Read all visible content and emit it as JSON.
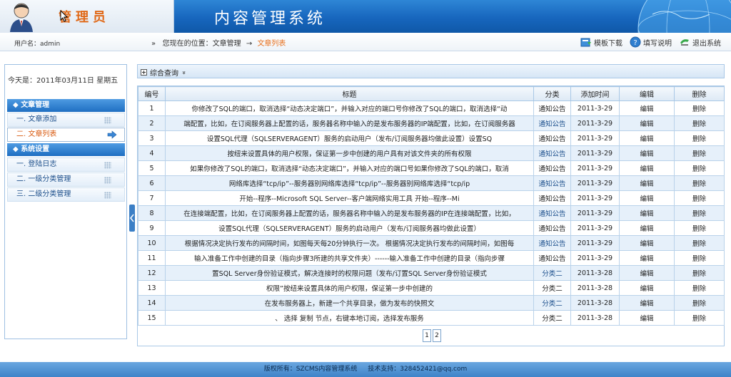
{
  "header": {
    "admin_title": "管理员",
    "system_title": "内容管理系统"
  },
  "bar2": {
    "username": "用户名：admin",
    "crumb_prefix": "»",
    "crumb_location": "您现在的位置：文章管理",
    "crumb_arrow": "→",
    "crumb_current": "文章列表",
    "toolbar": [
      {
        "label": "模板下载",
        "icon": "download-icon"
      },
      {
        "label": "填写说明",
        "icon": "help-icon"
      },
      {
        "label": "退出系统",
        "icon": "exit-icon"
      }
    ]
  },
  "sidebar": {
    "date": "今天是：2011年03月11日 星期五",
    "sections": [
      {
        "title": "文章管理",
        "items": [
          "一. 文章添加",
          "二. 文章列表"
        ]
      },
      {
        "title": "系统设置",
        "items": [
          "一. 登陆日志",
          "二. 一级分类管理",
          "三. 二级分类管理"
        ]
      }
    ]
  },
  "query": {
    "label": "综合查询",
    "toggle": "»"
  },
  "table": {
    "headers": [
      "编号",
      "标题",
      "分类",
      "添加时间",
      "编辑",
      "删除"
    ],
    "rows": [
      {
        "id": "1",
        "title": "你修改了SQL的端口，取消选择“动态决定端口”，并输入对应的端口号你修改了SQL的端口，取消选择“动",
        "cat": "通知公告",
        "date": "2011-3-29",
        "edit": "编辑",
        "del": "删除"
      },
      {
        "id": "2",
        "title": "端配置，比如，在订阅服务器上配置的话，服务器名称中输入的是发布服务器的IP端配置，比如，在订阅服务器",
        "cat": "通知公告",
        "date": "2011-3-29",
        "edit": "编辑",
        "del": "删除"
      },
      {
        "id": "3",
        "title": "设置SQL代理（SQLSERVERAGENT）服务的启动用户（发布/订阅服务器均做此设置）设置SQ",
        "cat": "通知公告",
        "date": "2011-3-29",
        "edit": "编辑",
        "del": "删除"
      },
      {
        "id": "4",
        "title": "按纽来设置具体的用户权限，保证第一步中创建的用户具有对该文件夹的所有权限",
        "cat": "通知公告",
        "date": "2011-3-29",
        "edit": "编辑",
        "del": "删除"
      },
      {
        "id": "5",
        "title": "如果你修改了SQL的端口，取消选择“动态决定端口”，并输入对应的端口号如果你修改了SQL的端口，取消",
        "cat": "通知公告",
        "date": "2011-3-29",
        "edit": "编辑",
        "del": "删除"
      },
      {
        "id": "6",
        "title": "网络库选择“tcp/ip”--服务器别网络库选择“tcp/ip”--服务器别网络库选择“tcp/ip",
        "cat": "通知公告",
        "date": "2011-3-29",
        "edit": "编辑",
        "del": "删除"
      },
      {
        "id": "7",
        "title": "开始--程序--Microsoft SQL Server--客户端网络实用工具 开始--程序--Mi",
        "cat": "通知公告",
        "date": "2011-3-29",
        "edit": "编辑",
        "del": "删除"
      },
      {
        "id": "8",
        "title": "在连接端配置，比如，在订阅服务器上配置的话，服务器名称中输入的是发布服务器的IP在连接端配置，比如，",
        "cat": "通知公告",
        "date": "2011-3-29",
        "edit": "编辑",
        "del": "删除"
      },
      {
        "id": "9",
        "title": "设置SQL代理（SQLSERVERAGENT）服务的启动用户（发布/订阅服务器均做此设置）",
        "cat": "通知公告",
        "date": "2011-3-29",
        "edit": "编辑",
        "del": "删除"
      },
      {
        "id": "10",
        "title": "根据情况决定执行发布的间隔时间，如图每天每20分钟执行一次。 根据情况决定执行发布的间隔时间，如图每",
        "cat": "通知公告",
        "date": "2011-3-29",
        "edit": "编辑",
        "del": "删除"
      },
      {
        "id": "11",
        "title": "输入准备工作中创建的目录（指向步骤3所建的共享文件夹）------输入准备工作中创建的目录（指向步骤",
        "cat": "通知公告",
        "date": "2011-3-29",
        "edit": "编辑",
        "del": "删除"
      },
      {
        "id": "12",
        "title": "置SQL Server身份验证模式，解决连接时的权限问题（发布/订置SQL Server身份验证模式",
        "cat": "分类二",
        "date": "2011-3-28",
        "edit": "编辑",
        "del": "删除"
      },
      {
        "id": "13",
        "title": "权限”按纽来设置具体的用户权限，保证第一步中创建的",
        "cat": "分类二",
        "date": "2011-3-28",
        "edit": "编辑",
        "del": "删除"
      },
      {
        "id": "14",
        "title": "在发布服务器上，新建一个共享目录，做为发布的快照文",
        "cat": "分类二",
        "date": "2011-3-28",
        "edit": "编辑",
        "del": "删除"
      },
      {
        "id": "15",
        "title": "、 选择 复制 节点，右键本地订阅，选择发布服务",
        "cat": "分类二",
        "date": "2011-3-28",
        "edit": "编辑",
        "del": "删除"
      }
    ]
  },
  "pager": {
    "pages": [
      "1",
      "2"
    ]
  },
  "footer": {
    "copyright": "版权所有：SZCMS内容管理系统",
    "support": "技术支持：328452421@qq.com"
  },
  "colors": {
    "header_blue": "#1766bd",
    "accent_orange": "#e06a1a",
    "link_blue": "#1a4d8a"
  }
}
